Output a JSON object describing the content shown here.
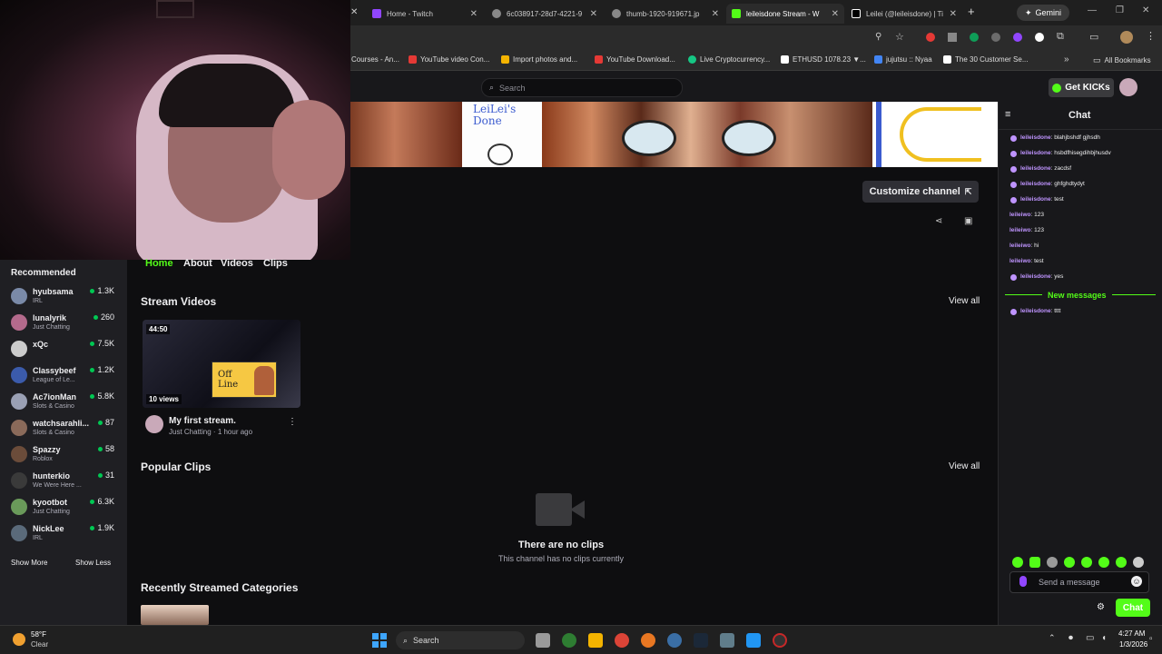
{
  "browser": {
    "tabs": [
      {
        "title": "Home - Twitch",
        "color": "#9146ff"
      },
      {
        "title": "6c038917-28d7-4221-9",
        "color": "#888888"
      },
      {
        "title": "thumb-1920-919671.jp",
        "color": "#888888"
      },
      {
        "title": "leileisdone Stream - W",
        "color": "#53fc18",
        "active": true
      },
      {
        "title": "Leilei (@leileisdone) | Ti",
        "color": "#ffffff"
      }
    ],
    "new_tab": "+",
    "profile_label": "Gemini",
    "bookmarks": [
      {
        "label": "Courses - An...",
        "color": "#aaaaaa"
      },
      {
        "label": "YouTube video Con...",
        "color": "#e53935"
      },
      {
        "label": "Import photos and...",
        "color": "#f4b400"
      },
      {
        "label": "YouTube Download...",
        "color": "#e53935"
      },
      {
        "label": "Live Cryptocurrency...",
        "color": "#16c784"
      },
      {
        "label": "ETHUSD 1078.23 ▼...",
        "color": "#ffffff"
      },
      {
        "label": "jujutsu :: Nyaa",
        "color": "#4285f4"
      },
      {
        "label": "The 30 Customer Se...",
        "color": "#ffffff"
      }
    ],
    "all_bookmarks": "All Bookmarks"
  },
  "twitch": {
    "search_placeholder": "Search",
    "kicks_label": "Get KICKs",
    "banner_text": "LeiLei's Done",
    "customize_label": "Customize channel",
    "tabs": [
      "Home",
      "About",
      "Videos",
      "Clips"
    ],
    "recommended_title": "Recommended",
    "recommended": [
      {
        "name": "hyubsama",
        "category": "IRL",
        "viewers": "1.3K",
        "color": "#7a8aa8"
      },
      {
        "name": "lunalyrik",
        "category": "Just Chatting",
        "viewers": "260",
        "color": "#b46a8c"
      },
      {
        "name": "xQc",
        "category": "",
        "viewers": "7.5K",
        "color": "#cccccc"
      },
      {
        "name": "Classybeef",
        "category": "League of Le...",
        "viewers": "1.2K",
        "color": "#3b5bab"
      },
      {
        "name": "Ac7ionMan",
        "category": "Slots & Casino",
        "viewers": "5.8K",
        "color": "#9aa0b4"
      },
      {
        "name": "watchsarahli...",
        "category": "Slots & Casino",
        "viewers": "87",
        "color": "#8a6a5a"
      },
      {
        "name": "Spazzy",
        "category": "Roblox",
        "viewers": "58",
        "color": "#6b4c3a"
      },
      {
        "name": "hunterkio",
        "category": "We Were Here ...",
        "viewers": "31",
        "color": "#3a3a3a"
      },
      {
        "name": "kyootbot",
        "category": "Just Chatting",
        "viewers": "6.3K",
        "color": "#6a9a5a"
      },
      {
        "name": "NickLee",
        "category": "IRL",
        "viewers": "1.9K",
        "color": "#5a6a7a"
      }
    ],
    "show_more": "Show More",
    "show_less": "Show Less",
    "stream_videos_title": "Stream Videos",
    "popular_clips_title": "Popular Clips",
    "recent_categories_title": "Recently Streamed Categories",
    "view_all": "View all",
    "video": {
      "duration": "44:50",
      "views": "10 views",
      "thumb_text": "Off Line",
      "title": "My first stream.",
      "category": "Just Chatting",
      "age": "1 hour ago",
      "separator": " · "
    },
    "no_clips_title": "There are no clips",
    "no_clips_sub": "This channel has no clips currently"
  },
  "chat": {
    "title": "Chat",
    "messages": [
      {
        "user": "leileisdone",
        "text": "blahjbshdf gjhsdh",
        "badge": true
      },
      {
        "user": "leileisdone",
        "text": "hsbdfhisegdihbjhusdv",
        "badge": true
      },
      {
        "user": "leileisdone",
        "text": "zacdsf",
        "badge": true
      },
      {
        "user": "leileisdone",
        "text": "ghfghdtydyt",
        "badge": true
      },
      {
        "user": "leileisdone",
        "text": "test",
        "badge": true
      },
      {
        "user": "leileiwo",
        "text": "123",
        "badge": false
      },
      {
        "user": "leileiwo",
        "text": "123",
        "badge": false
      },
      {
        "user": "leileiwo",
        "text": "hi",
        "badge": false
      },
      {
        "user": "leileiwo",
        "text": "test",
        "badge": false
      },
      {
        "user": "leileisdone",
        "text": "yes",
        "badge": true
      }
    ],
    "new_messages": "New messages",
    "after_new": {
      "user": "leileisdone",
      "text": "tttt",
      "badge": true
    },
    "input_placeholder": "Send a message",
    "send_label": "Chat",
    "separator": ": "
  },
  "taskbar": {
    "weather_temp": "58°F",
    "weather_desc": "Clear",
    "search_label": "Search",
    "time": "4:27 AM",
    "date": "1/3/2026"
  }
}
